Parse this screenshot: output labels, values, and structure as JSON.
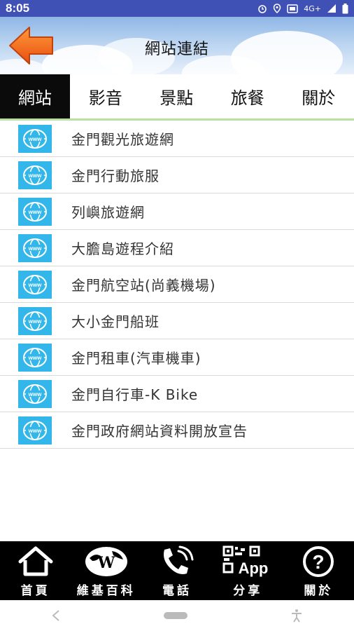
{
  "status": {
    "time": "8:05",
    "network": "4G+"
  },
  "header": {
    "title": "網站連結"
  },
  "tabs": [
    {
      "label": "網站",
      "active": true
    },
    {
      "label": "影音",
      "active": false
    },
    {
      "label": "景點",
      "active": false
    },
    {
      "label": "旅餐",
      "active": false
    },
    {
      "label": "關於",
      "active": false
    }
  ],
  "links": [
    {
      "label": "金門觀光旅遊網"
    },
    {
      "label": "金門行動旅服"
    },
    {
      "label": "列嶼旅遊網"
    },
    {
      "label": "大膽島遊程介紹"
    },
    {
      "label": "金門航空站(尚義機場)"
    },
    {
      "label": "大小金門船班"
    },
    {
      "label": "金門租車(汽車機車)"
    },
    {
      "label": "金門自行車-K Bike"
    },
    {
      "label": "金門政府網站資料開放宣告"
    }
  ],
  "bottom_nav": [
    {
      "label": "首頁",
      "icon": "home-icon"
    },
    {
      "label": "維基百科",
      "icon": "wikipedia-globe-icon"
    },
    {
      "label": "電話",
      "icon": "phone-icon"
    },
    {
      "label": "分享",
      "icon": "qr-app-share-icon"
    },
    {
      "label": "關於",
      "icon": "help-icon"
    }
  ],
  "colors": {
    "status_bar": "#3f51b5",
    "www_icon": "#33b7ea",
    "tab_active_bg": "#0b0b0b",
    "tab_underline": "#b6e1a0",
    "arrow": "#f26522"
  }
}
